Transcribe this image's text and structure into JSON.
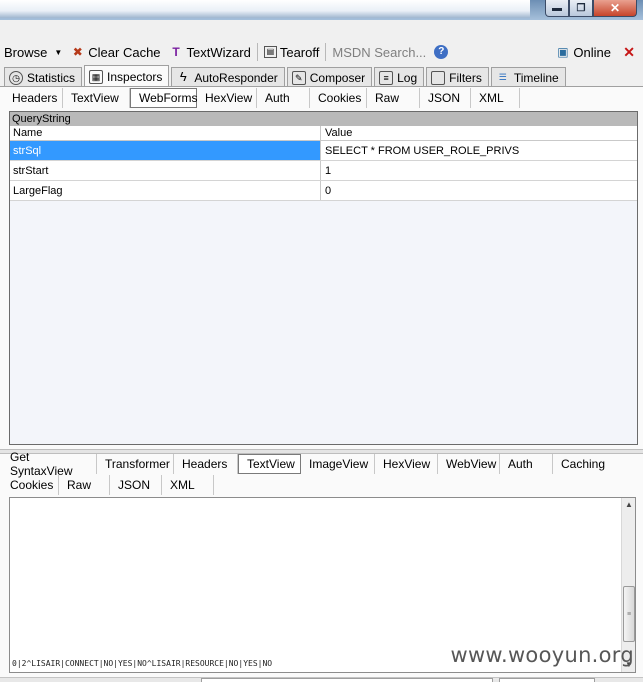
{
  "toolbar": {
    "browse": "Browse",
    "clear_cache": "Clear Cache",
    "textwizard": "TextWizard",
    "tearoff": "Tearoff",
    "msdn_search": "MSDN Search...",
    "online": "Online",
    "close": "✕"
  },
  "main_tabs": [
    {
      "label": "Statistics",
      "icon": "clock-icon"
    },
    {
      "label": "Inspectors",
      "icon": "inspector-icon"
    },
    {
      "label": "AutoResponder",
      "icon": "lightning-icon"
    },
    {
      "label": "Composer",
      "icon": "pencil-icon"
    },
    {
      "label": "Log",
      "icon": "log-icon"
    },
    {
      "label": "Filters",
      "icon": "checkbox-icon"
    },
    {
      "label": "Timeline",
      "icon": "timeline-icon"
    }
  ],
  "request_tabs": [
    "Headers",
    "TextView",
    "WebForms",
    "HexView",
    "Auth",
    "Cookies",
    "Raw",
    "JSON",
    "XML"
  ],
  "querystring": {
    "caption": "QueryString",
    "col_name": "Name",
    "col_value": "Value",
    "rows": [
      {
        "name": "strSql",
        "value": "SELECT * FROM USER_ROLE_PRIVS"
      },
      {
        "name": "strStart",
        "value": "1"
      },
      {
        "name": "LargeFlag",
        "value": "0"
      }
    ]
  },
  "response_tabs_row1": [
    "Get SyntaxView",
    "Transformer",
    "Headers",
    "TextView",
    "ImageView",
    "HexView",
    "WebView",
    "Auth",
    "Caching"
  ],
  "response_tabs_row2": [
    "Cookies",
    "Raw",
    "JSON",
    "XML"
  ],
  "response_text": "0|2^LISAIR|CONNECT|NO|YES|NO^LISAIR|RESOURCE|NO|YES|NO",
  "watermark": "www.wooyun.org"
}
